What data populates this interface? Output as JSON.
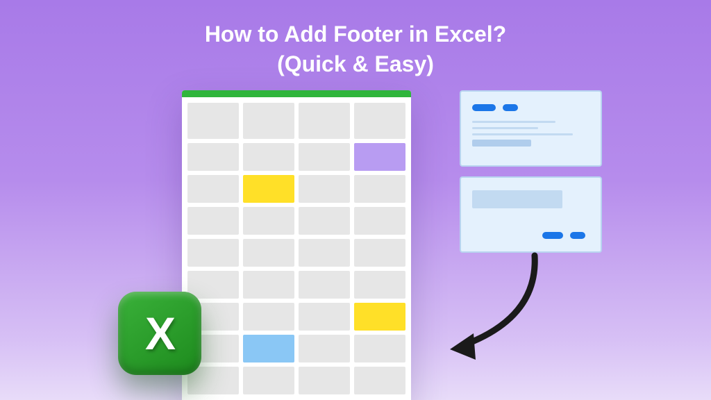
{
  "title": {
    "line1": "How to Add Footer in Excel?",
    "line2": "(Quick & Easy)"
  },
  "excel": {
    "letter": "X"
  }
}
